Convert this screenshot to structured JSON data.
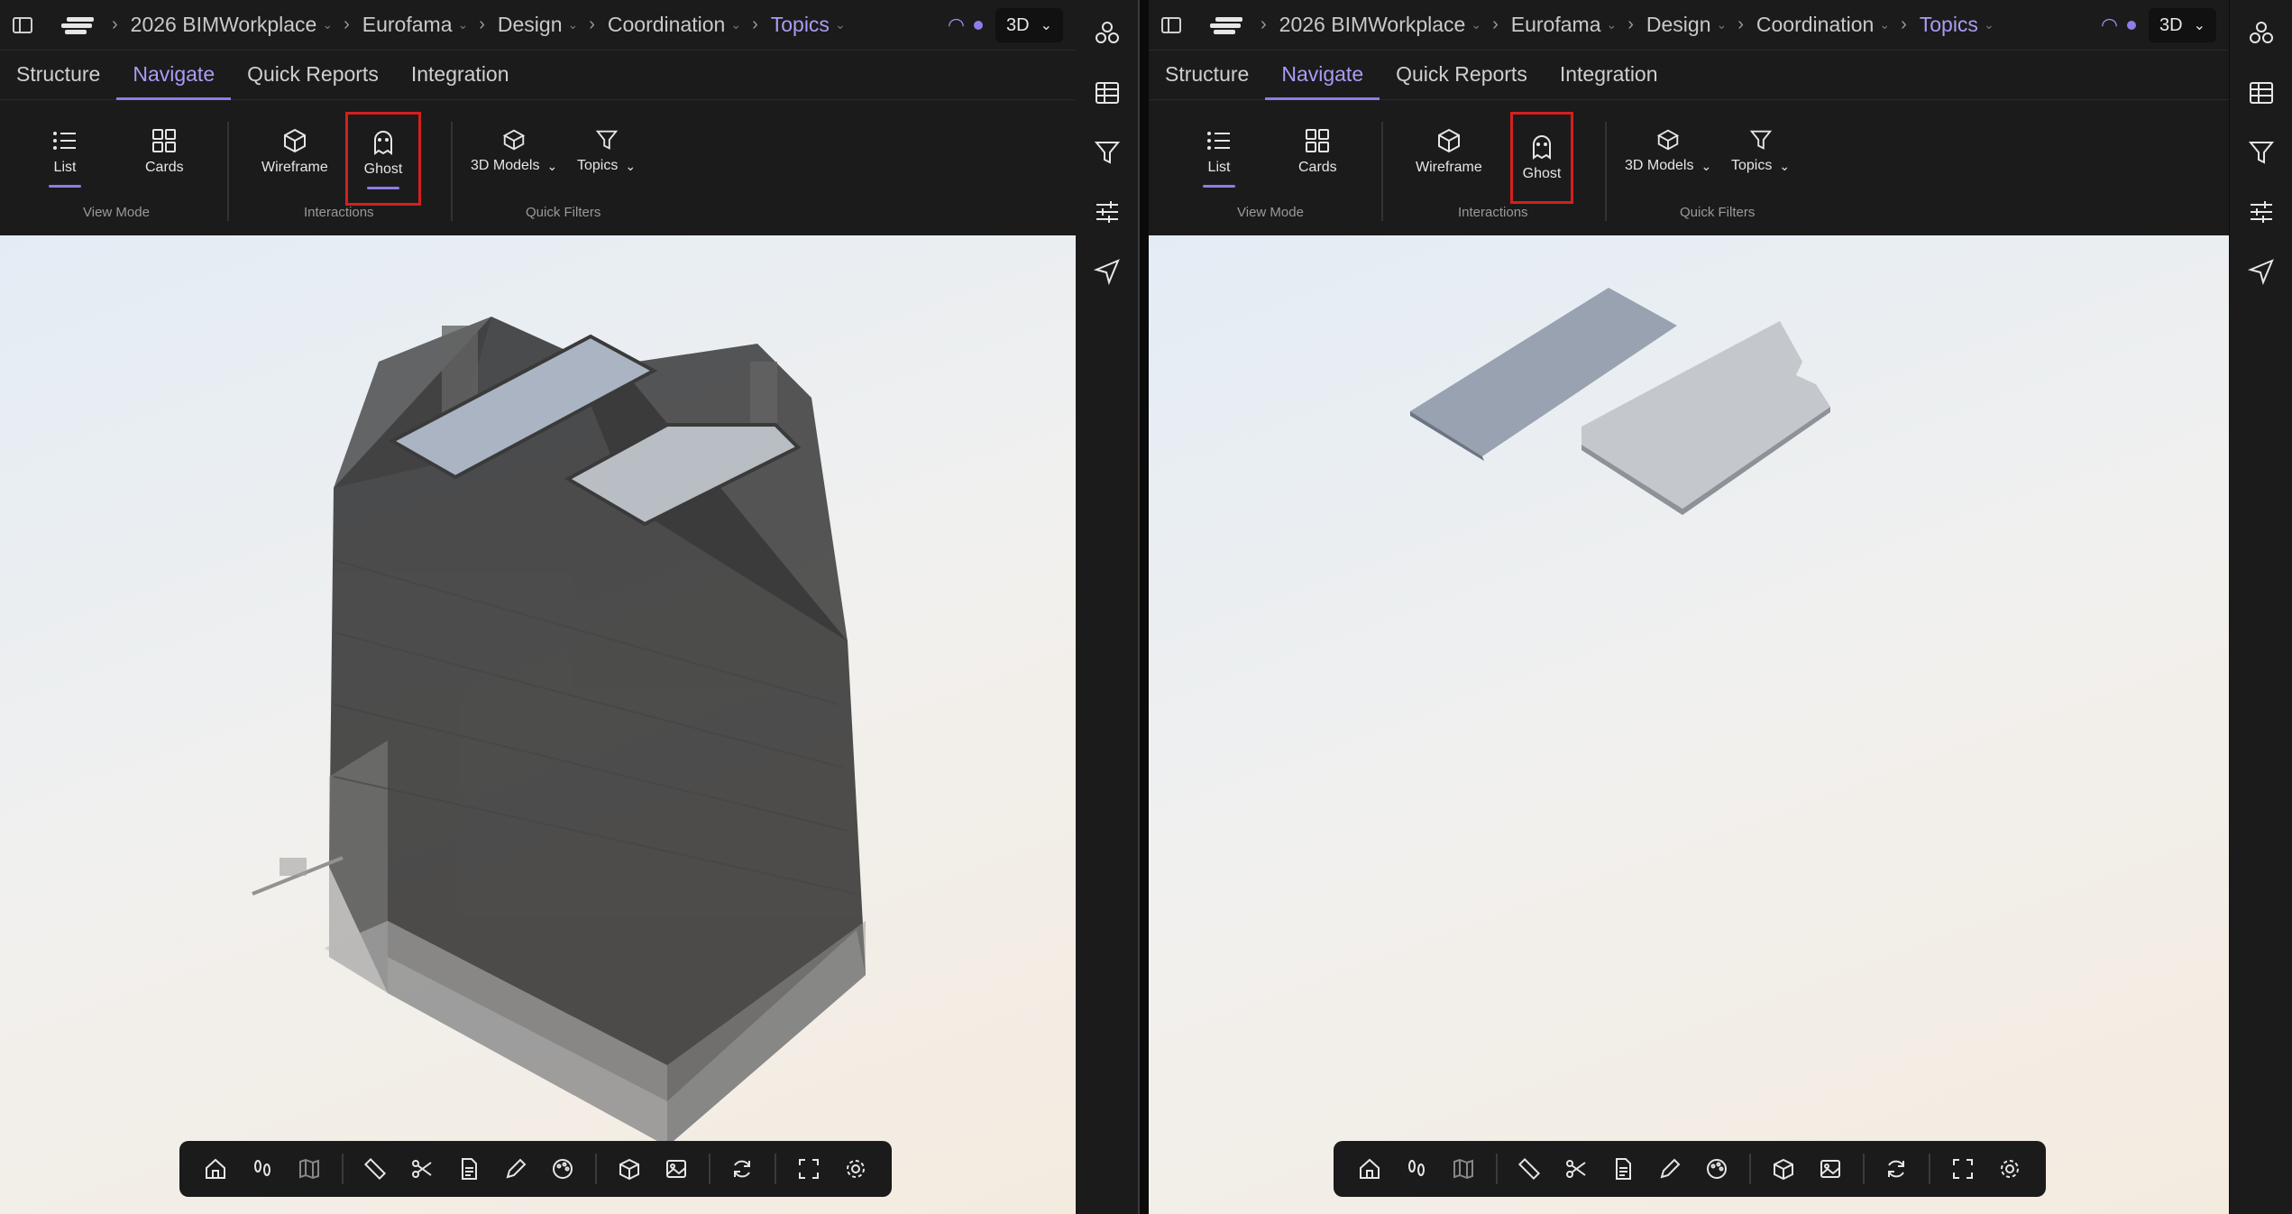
{
  "header": {
    "crumbs": [
      "2026 BIMWorkplace",
      "Eurofama",
      "Design",
      "Coordination",
      "Topics"
    ],
    "view_mode": "3D"
  },
  "tabs": [
    "Structure",
    "Navigate",
    "Quick Reports",
    "Integration"
  ],
  "ribbon": {
    "list_label": "List",
    "cards_label": "Cards",
    "wireframe_label": "Wireframe",
    "ghost_label": "Ghost",
    "models_label": "3D Models",
    "topics_label": "Topics",
    "group_view_mode": "View Mode",
    "group_interactions": "Interactions",
    "group_quick_filters": "Quick Filters"
  },
  "selected_tab": "Navigate",
  "highlight_color": "#d42020",
  "accent_color": "#8f7ce8",
  "bottom_toolbar_icons": [
    "home-icon",
    "walk-icon",
    "map-icon",
    "ruler-icon",
    "scissors-icon",
    "document-icon",
    "pencil-icon",
    "palette-icon",
    "cube-icon",
    "image-icon",
    "refresh-icon",
    "fullscreen-icon",
    "settings-icon"
  ],
  "rail_icons": [
    "models-icon",
    "table-icon",
    "filter-icon",
    "sliders-icon",
    "navigate-icon"
  ]
}
